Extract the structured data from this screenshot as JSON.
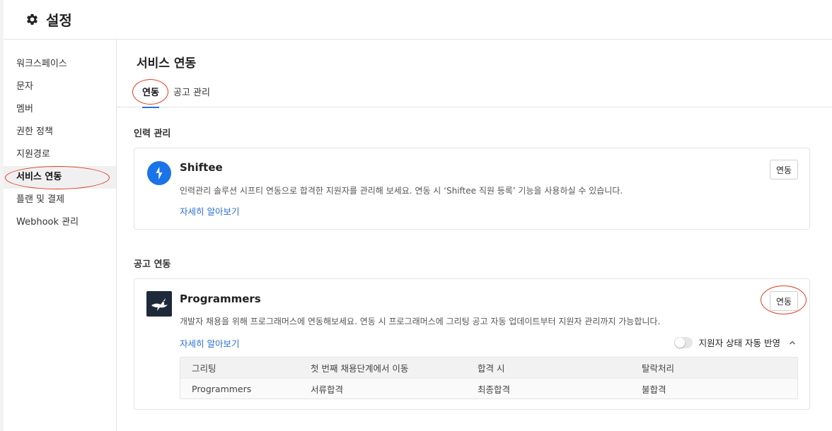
{
  "header": {
    "title": "설정",
    "icon": "gear-icon"
  },
  "sidebar": {
    "items": [
      {
        "label": "워크스페이스"
      },
      {
        "label": "문자"
      },
      {
        "label": "멤버"
      },
      {
        "label": "권한 정책"
      },
      {
        "label": "지원경로"
      },
      {
        "label": "서비스 연동",
        "active": true
      },
      {
        "label": "플랜 및 결제"
      },
      {
        "label": "Webhook 관리"
      }
    ]
  },
  "main": {
    "title": "서비스 연동",
    "tabs": [
      {
        "label": "연동",
        "active": true
      },
      {
        "label": "공고 관리"
      }
    ]
  },
  "sections": {
    "hr": {
      "title": "인력 관리",
      "card": {
        "name": "Shiftee",
        "description": "인력관리 솔루션 시프티 연동으로 합격한 지원자를 관리해 보세요. 연동 시 ‘Shiftee 직원 등록’ 기능을 사용하실 수 있습니다.",
        "more_link": "자세히 알아보기",
        "button": "연동",
        "logo_color": "#1a73e8"
      }
    },
    "job": {
      "title": "공고 연동",
      "card": {
        "name": "Programmers",
        "description": "개발자 채용을 위해 프로그래머스에 연동해보세요. 연동 시 프로그래머스에 그리팅 공고 자동 업데이트부터 지원자 관리까지 가능합니다.",
        "more_link": "자세히 알아보기",
        "button": "연동",
        "logo_color": "#1e2a3a",
        "toggle_label": "지원자 상태 자동 반영",
        "toggle_on": false,
        "table": {
          "headers": [
            "그리팅",
            "첫 번째 채용단계에서 이동",
            "합격 시",
            "탈락처리"
          ],
          "rows": [
            [
              "Programmers",
              "서류합격",
              "최종합격",
              "불합격"
            ]
          ]
        }
      }
    }
  },
  "annotations": {
    "circle_color": "#e23b1f"
  }
}
